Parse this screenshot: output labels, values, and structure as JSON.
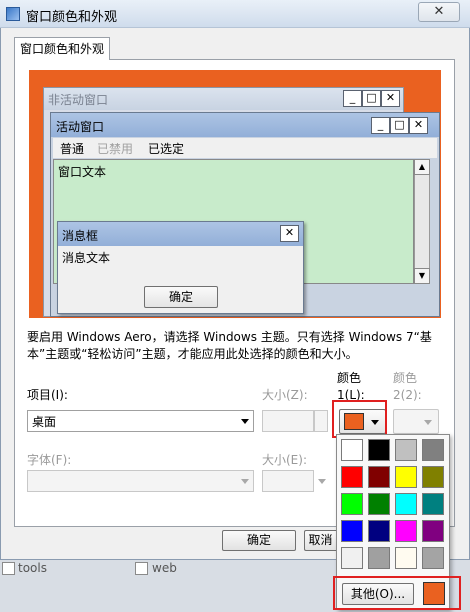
{
  "window": {
    "title": "窗口颜色和外观",
    "close": "✕"
  },
  "tabs": [
    {
      "label": "窗口颜色和外观"
    }
  ],
  "preview": {
    "inactive_title": "非活动窗口",
    "active_title": "活动窗口",
    "menu": [
      "普通",
      "已禁用",
      "已选定"
    ],
    "window_text": "窗口文本",
    "message_title": "消息框",
    "message_text": "消息文本",
    "message_ok": "确定",
    "btn_min": "_",
    "btn_max": "□",
    "btn_close": "✕"
  },
  "hint": "要启用 Windows Aero，请选择 Windows 主题。只有选择 Windows 7“基本”主题或“轻松访问”主题，才能应用此处选择的颜色和大小。",
  "item": {
    "label": "项目(I):",
    "value": "桌面"
  },
  "size1_label": "大小(Z):",
  "color1_label": "颜色 1(L):",
  "color2_label": "颜色 2(2):",
  "font": {
    "label": "字体(F):"
  },
  "size2_label": "大小(E):",
  "palette": {
    "swatches": [
      "#ffffff",
      "#000000",
      "#c0c0c0",
      "#808080",
      "#ff0000",
      "#800000",
      "#ffff00",
      "#808000",
      "#00ff00",
      "#008000",
      "#00ffff",
      "#008080",
      "#0000ff",
      "#000080",
      "#ff00ff",
      "#800080",
      "#f0f0f0",
      "#a0a0a0",
      "#fffbf0",
      "#a4a4a4"
    ],
    "other_label": "其他(O)...",
    "current_color": "#ea6120"
  },
  "buttons": {
    "ok": "确定",
    "cancel": "取消"
  },
  "background": {
    "check1": "tools",
    "check2": "web"
  },
  "colors": {
    "accent": "#ea6120",
    "window_bg": "#c8ebcb",
    "highlight": "#e02020"
  }
}
